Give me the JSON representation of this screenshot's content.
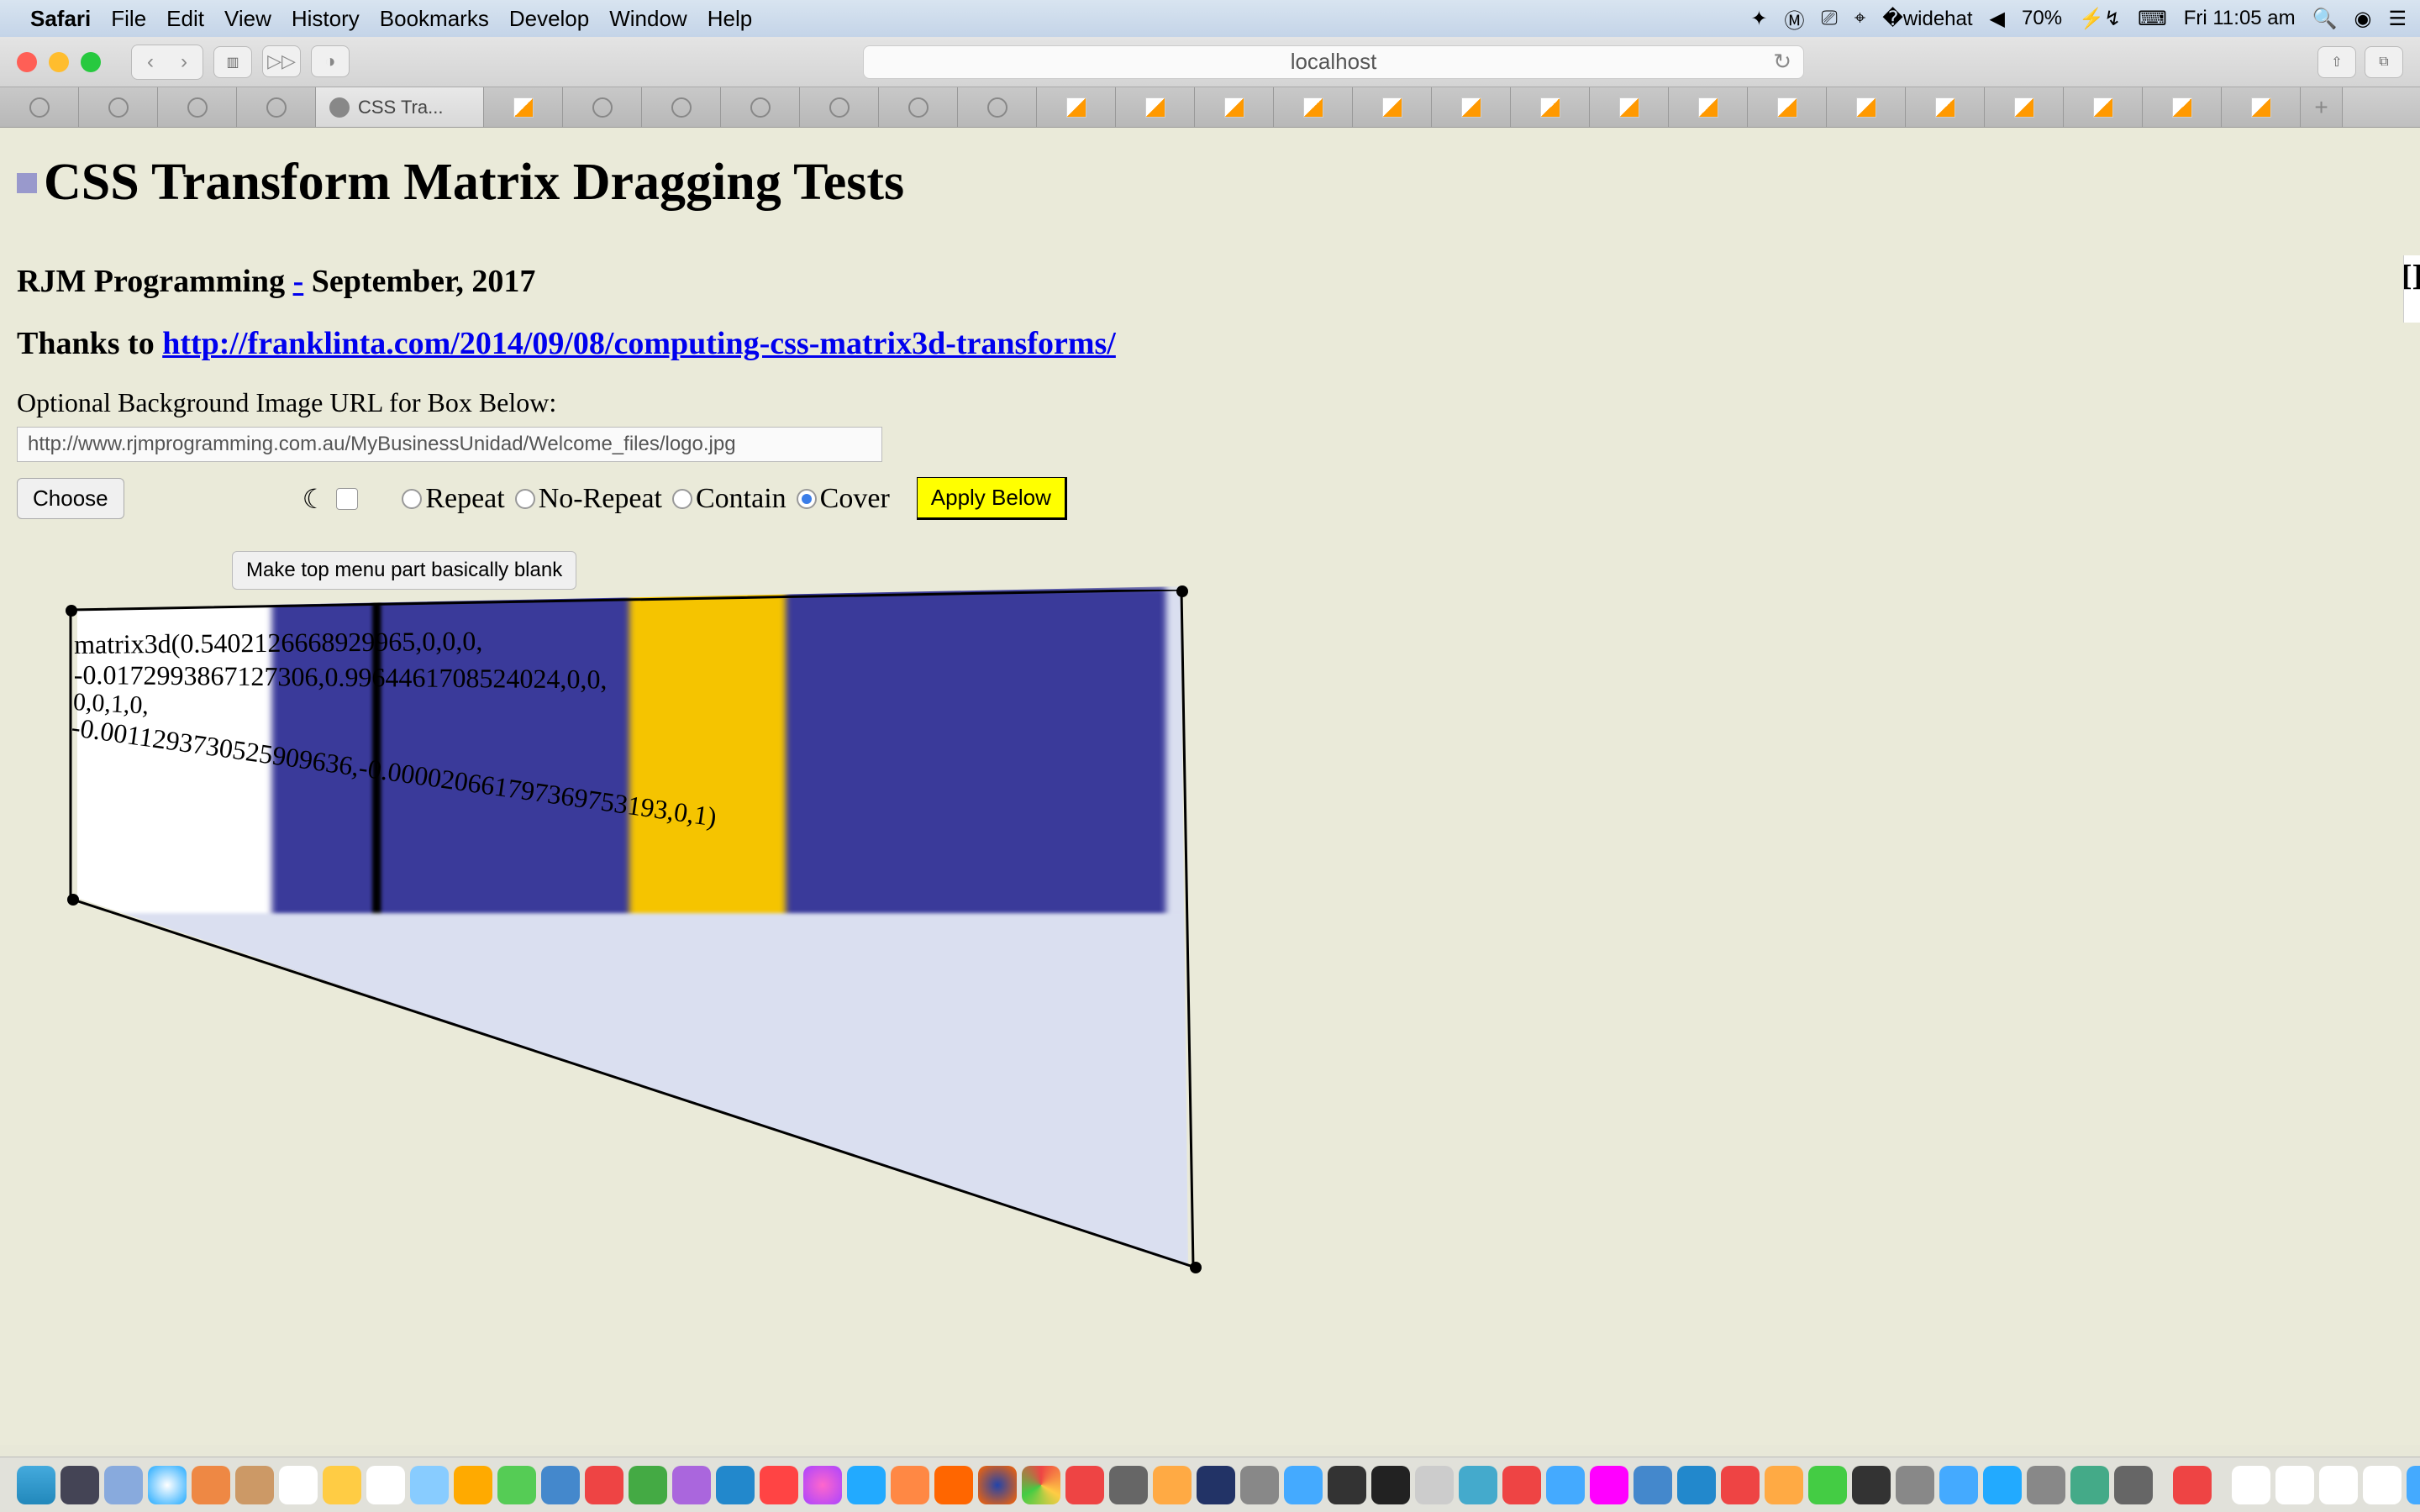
{
  "menubar": {
    "app": "Safari",
    "items": [
      "File",
      "Edit",
      "View",
      "History",
      "Bookmarks",
      "Develop",
      "Window",
      "Help"
    ],
    "battery": "70%",
    "clock": "Fri 11:05 am"
  },
  "safari": {
    "url": "localhost",
    "activeTab": "CSS Tra..."
  },
  "page": {
    "h1": "CSS Transform Matrix Dragging Tests",
    "byline_pre": "RJM Programming ",
    "byline_sep": "-",
    "byline_post": " September, 2017",
    "thanks_pre": "Thanks to ",
    "thanks_link": "http://franklinta.com/2014/09/08/computing-css-matrix3d-transforms/",
    "bg_label": "Optional Background Image URL for Box Below:",
    "bg_url": "http://www.rjmprogramming.com.au/MyBusinessUnidad/Welcome_files/logo.jpg",
    "choose": "Choose",
    "repeat_options": {
      "repeat": "Repeat",
      "no_repeat": "No-Repeat",
      "contain": "Contain",
      "cover": "Cover"
    },
    "apply": "Apply Below",
    "make_blank": "Make top menu part basically blank",
    "matrix_lines": {
      "l1": "matrix3d(0.5402126668929965,0,0,0,",
      "l2": "-0.0172993867127306,0.9964461708524024,0,0,",
      "l3": "0,0,1,0,",
      "l4": "-0.0011293730525909636,-0.000020661797369753193,0,1)"
    }
  },
  "right_edge": "II"
}
